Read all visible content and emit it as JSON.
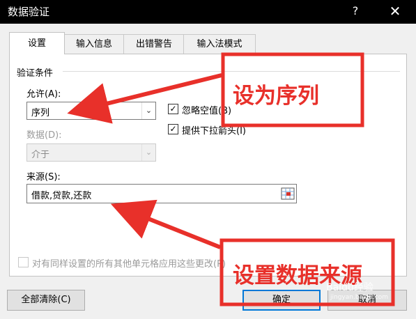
{
  "window": {
    "title": "数据验证",
    "help": "?",
    "close": "✕"
  },
  "tabs": [
    {
      "label": "设置",
      "active": true
    },
    {
      "label": "输入信息",
      "active": false
    },
    {
      "label": "出错警告",
      "active": false
    },
    {
      "label": "输入法模式",
      "active": false
    }
  ],
  "criteria": {
    "group_label": "验证条件",
    "allow_label": "允许(A):",
    "allow_value": "序列",
    "data_label": "数据(D):",
    "data_value": "介于",
    "ignore_blank_label": "忽略空值(B)",
    "ignore_blank_checked": "✓",
    "dropdown_label": "提供下拉箭头(I)",
    "dropdown_checked": "✓",
    "source_label": "来源(S):",
    "source_value": "借款,贷款,还款"
  },
  "apply_all_label": "对有同样设置的所有其他单元格应用这些更改(P)",
  "buttons": {
    "clear_all": "全部清除(C)",
    "ok": "确定",
    "cancel": "取消"
  },
  "annotations": {
    "set_sequence": "设为序列",
    "set_source": "设置数据来源",
    "accent_color": "#e8302a"
  },
  "watermark": {
    "main": "Baidu经验",
    "sub": "jingyan.baidu.com"
  },
  "icons": {
    "dropdown": "chevron-down-icon",
    "range_select": "range-select-icon",
    "check": "checkmark-icon"
  }
}
